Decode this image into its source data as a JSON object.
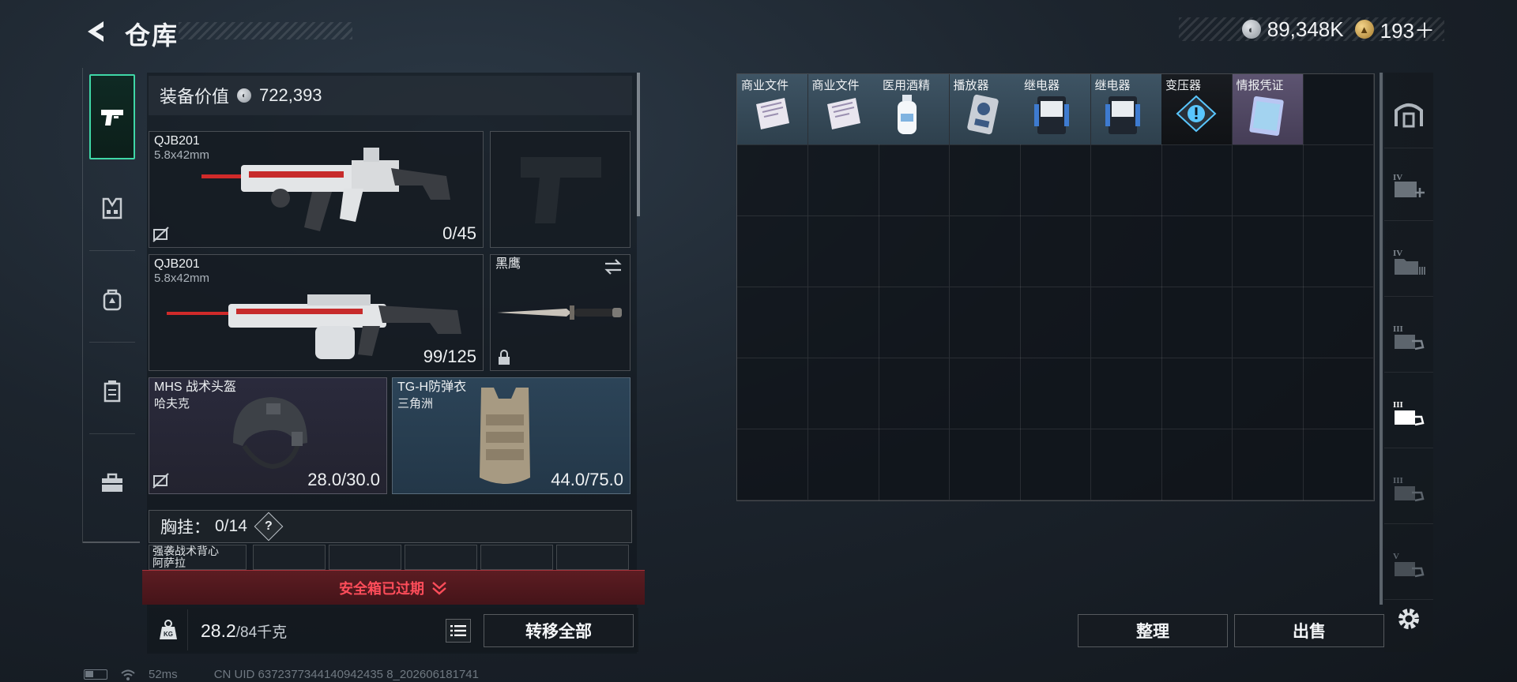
{
  "header": {
    "title": "仓库",
    "currency_silver": "89,348K",
    "currency_gold": "193＋"
  },
  "loadout": {
    "value_label": "装备价值",
    "value": "722,393",
    "primary1": {
      "name": "QJB201",
      "ammo": "5.8x42mm",
      "count": "0/45"
    },
    "primary2": {
      "name": "QJB201",
      "ammo": "5.8x42mm",
      "count": "99/125"
    },
    "melee": {
      "name": "黑鹰"
    },
    "helmet": {
      "name": "MHS 战术头盔",
      "sub": "哈夫克",
      "durability": "28.0/30.0"
    },
    "armor": {
      "name": "TG-H防弹衣",
      "sub": "三角洲",
      "durability": "44.0/75.0"
    },
    "chest": {
      "label": "胸挂：",
      "count": "0/14",
      "help": "?"
    },
    "chest_item": {
      "name": "强袭战术背心",
      "sub": "阿萨拉"
    },
    "warning": "安全箱已过期",
    "weight": "28.2",
    "weight_max": "/84千克",
    "transfer_all": "转移全部"
  },
  "stash": {
    "items": [
      {
        "name": "商业文件",
        "style": "blue",
        "icon": "document-icon"
      },
      {
        "name": "商业文件",
        "style": "blue",
        "icon": "document-icon"
      },
      {
        "name": "医用酒精",
        "style": "blue",
        "icon": "bottle-icon"
      },
      {
        "name": "播放器",
        "style": "blue",
        "icon": "media-player-icon"
      },
      {
        "name": "继电器",
        "style": "blue",
        "icon": "relay-icon"
      },
      {
        "name": "继电器",
        "style": "blue",
        "icon": "relay-icon"
      },
      {
        "name": "变压器",
        "style": "dark",
        "icon": "warning-icon"
      },
      {
        "name": "情报凭证",
        "style": "purple",
        "icon": "intel-card-icon"
      }
    ],
    "sort_label": "整理",
    "sell_label": "出售"
  },
  "footer": {
    "ping": "52ms",
    "uid": "CN UID 6372377344140942435 8_202606181741"
  },
  "colors": {
    "accent": "#3fd7a6",
    "warning": "#ff4d5a",
    "blue_item": "#3e5464",
    "purple_item": "#5d5471"
  }
}
